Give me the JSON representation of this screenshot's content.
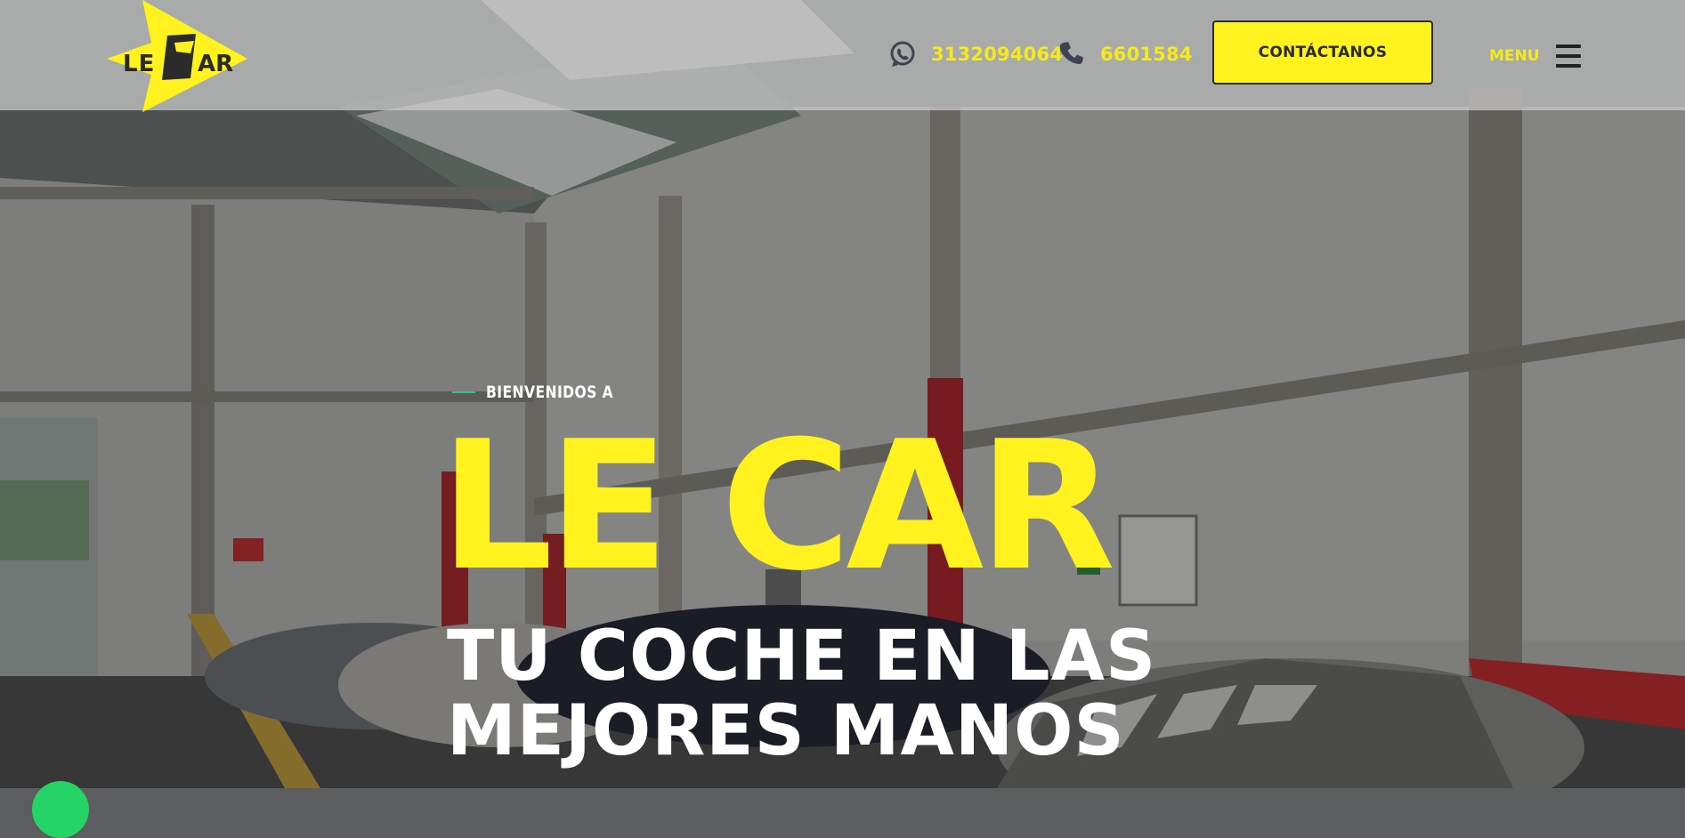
{
  "brand": {
    "name": "LE CAR",
    "logo_text": "LE CAR"
  },
  "header": {
    "whatsapp": {
      "icon": "whatsapp-icon",
      "number": "3132094064"
    },
    "phone": {
      "icon": "phone-icon",
      "number": "6601584"
    },
    "cta_label": "CONTÁCTANOS",
    "menu_label": "MENU",
    "menu_icon": "hamburger-icon"
  },
  "hero": {
    "eyebrow": "BIENVENIDOS A",
    "title": "LE CAR",
    "subtitle": "TU COCHE EN LAS MEJORES MANOS"
  },
  "colors": {
    "accent_yellow": "#fff21e",
    "number_yellow": "#f7ea1c",
    "eyebrow_line": "#35c08a",
    "header_bg": "#cdcdcd",
    "whatsapp_green": "#25d366"
  }
}
